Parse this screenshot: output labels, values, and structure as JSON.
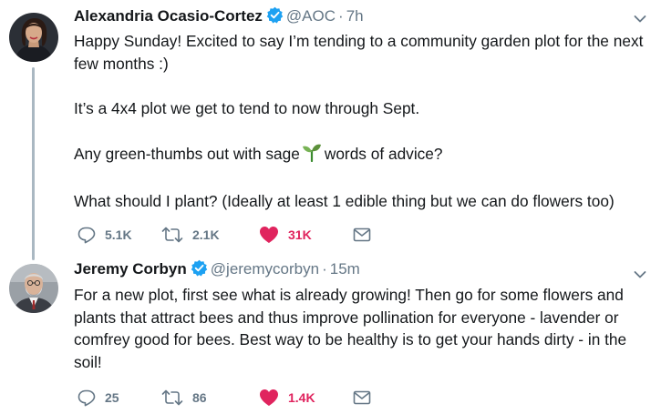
{
  "tweets": [
    {
      "name": "Alexandria Ocasio-Cortez",
      "handle": "@AOC",
      "separator": "·",
      "time": "7h",
      "paragraphs": [
        "Happy Sunday! Excited to say I’m tending to a community garden plot for the next few months :)",
        "It’s a 4x4 plot we get to tend to now through Sept.",
        "Any green-thumbs out with sage",
        "words of advice?",
        "What should I plant? (Ideally at least 1 edible thing but we can do flowers too)"
      ],
      "replies": "5.1K",
      "retweets": "2.1K",
      "likes": "31K"
    },
    {
      "name": "Jeremy Corbyn",
      "handle": "@jeremycorbyn",
      "separator": "·",
      "time": "15m",
      "paragraphs": [
        "For a new plot, first see what is already growing! Then go for some flowers and plants that attract bees and thus improve pollination for everyone - lavender or comfrey good for bees. Best way to be healthy is to get your hands dirty - in the soil!"
      ],
      "replies": "25",
      "retweets": "86",
      "likes": "1.4K"
    }
  ],
  "icons": {
    "reply": "reply-icon",
    "retweet": "retweet-icon",
    "like": "heart-icon",
    "dm": "envelope-icon",
    "verified": "verified-badge-icon",
    "emoji": "seedling-emoji-icon",
    "menu": "chevron-down-icon"
  },
  "colors": {
    "verified": "#1da1f2",
    "like": "#e0245e",
    "muted": "#657786",
    "thread_line": "#aab8c2",
    "text": "#14171a"
  }
}
